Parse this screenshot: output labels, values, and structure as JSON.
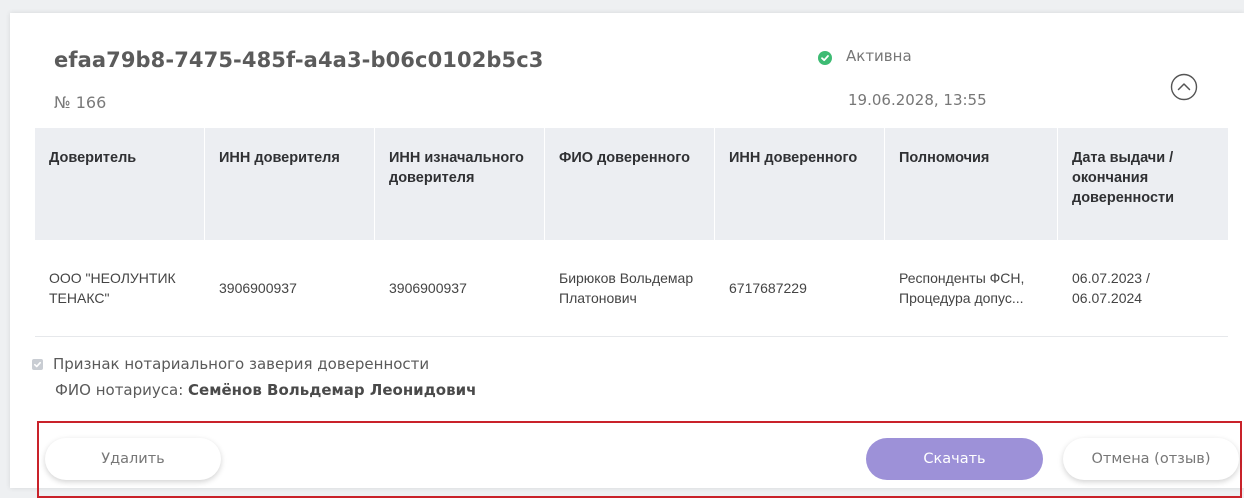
{
  "card": {
    "id": "efaa79b8-7475-485f-a4a3-b06c0102b5c3",
    "number": "№ 166",
    "status": {
      "label": "Активна",
      "date": "19.06.2028, 13:55",
      "color": "#3dbb73",
      "icon": "check-circle-icon"
    },
    "collapse_icon": "chevron-up-circle-icon"
  },
  "table": {
    "headers": [
      "Доверитель",
      "ИНН доверителя",
      "ИНН изначального доверителя",
      "ФИО доверенного",
      "ИНН доверенного",
      "Полномочия",
      "Дата выдачи / окончания доверенности"
    ],
    "rows": [
      {
        "principal": "ООО \"НЕОЛУНТИК ТЕНАКС\"",
        "principal_inn": "3906900937",
        "original_principal_inn": "3906900937",
        "attorney_name": "Бирюков Вольдемар Платонович",
        "attorney_inn": "6717687229",
        "powers": "Респонденты ФСН, Процедура допус...",
        "dates": "06.07.2023 / 06.07.2024"
      }
    ]
  },
  "notary": {
    "checkbox_label": "Признак нотариального заверия доверенности",
    "name_label": "ФИО нотариуса:",
    "name": "Семёнов Вольдемар Леонидович",
    "checked": true
  },
  "footer": {
    "delete_label": "Удалить",
    "download_label": "Скачать",
    "cancel_label": "Отмена (отзыв)",
    "accent_color": "#9d91d8",
    "highlight_color": "#c9222a"
  }
}
